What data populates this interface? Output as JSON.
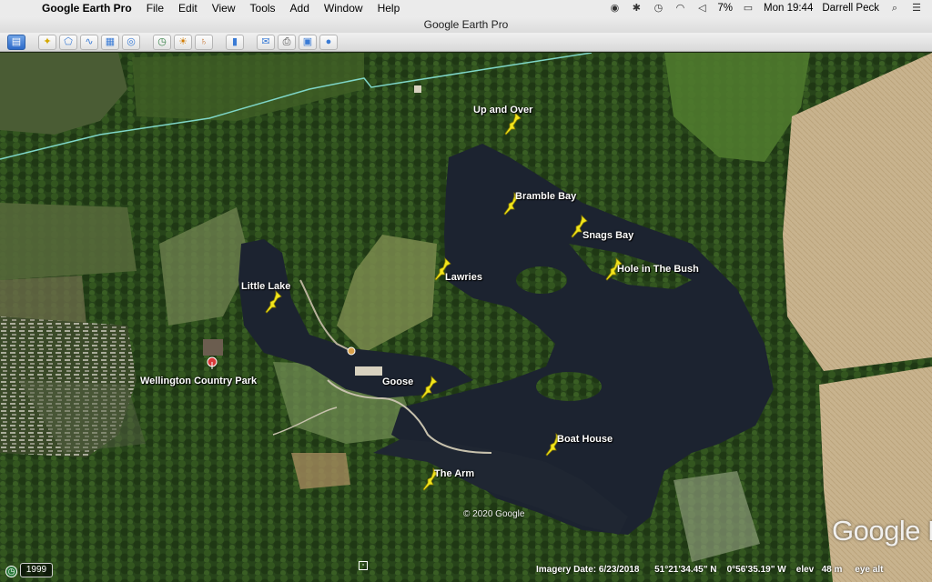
{
  "menubar": {
    "app_name": "Google Earth Pro",
    "items": [
      "File",
      "Edit",
      "View",
      "Tools",
      "Add",
      "Window",
      "Help"
    ],
    "battery": "7%",
    "clock": "Mon 19:44",
    "user": "Darrell Peck"
  },
  "window": {
    "title": "Google Earth Pro"
  },
  "toolbar": {
    "buttons": [
      "sidebar-toggle-icon",
      "placemark-icon",
      "polygon-icon",
      "path-icon",
      "image-overlay-icon",
      "record-tour-icon",
      "historical-imagery-icon",
      "sunlight-icon",
      "planets-icon",
      "ruler-icon",
      "email-icon",
      "print-icon",
      "save-image-icon",
      "view-in-maps-icon"
    ]
  },
  "map": {
    "placemarks": [
      {
        "label": "Up and Over"
      },
      {
        "label": "Bramble Bay"
      },
      {
        "label": "Snags Bay"
      },
      {
        "label": "Hole in The Bush"
      },
      {
        "label": "Lawries"
      },
      {
        "label": "Little Lake"
      },
      {
        "label": "Wellington Country Park"
      },
      {
        "label": "Goose"
      },
      {
        "label": "Boat House"
      },
      {
        "label": "The Arm"
      }
    ],
    "copyright": "© 2020 Google",
    "logo": "Google E"
  },
  "status": {
    "historical_year": "1999",
    "imagery_date_label": "Imagery Date:",
    "imagery_date": "6/23/2018",
    "lat": "51°21'34.45\" N",
    "lon": "0°56'35.19\" W",
    "elev_label": "elev",
    "elev": "48 m",
    "eye_alt_label": "eye alt"
  },
  "colors": {
    "pin": "#f2e51c",
    "water": "#1c2330",
    "forest": "#2a4a1c",
    "field": "#c9b591",
    "boundary": "#7fd6c8"
  }
}
